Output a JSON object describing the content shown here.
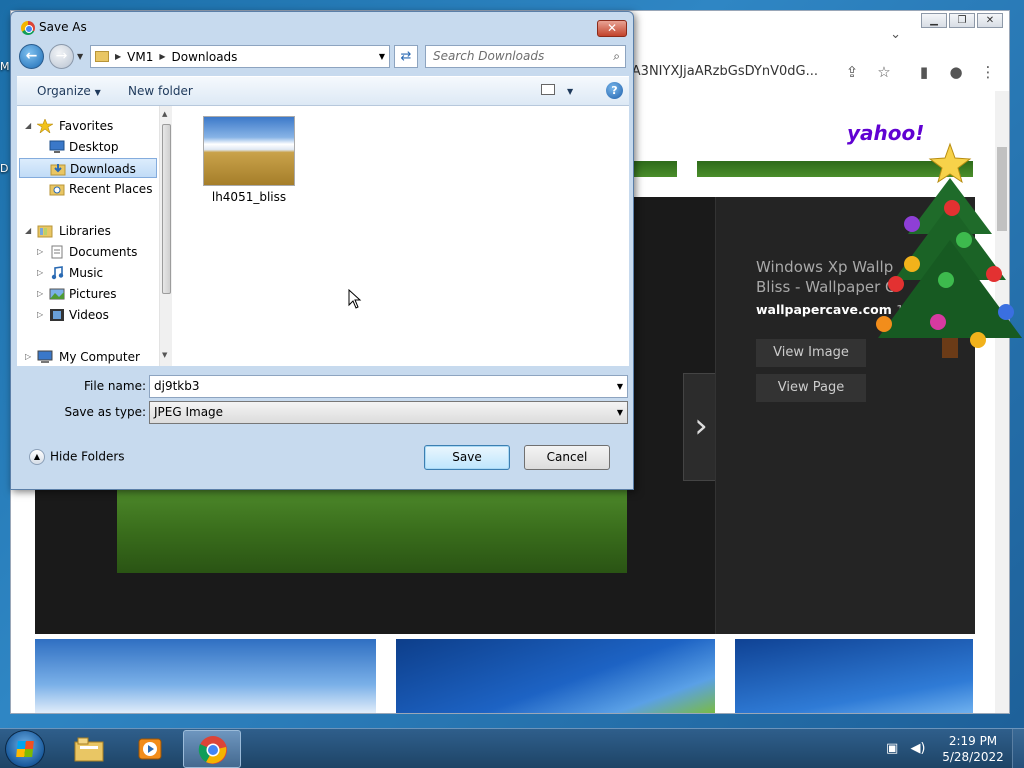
{
  "desktop": {
    "edge_labels": [
      "M",
      "D"
    ]
  },
  "browser": {
    "omnibox_text": "2VjA3NIYXJjaARzbGsDYnV0dG...",
    "window_controls": [
      "minimize",
      "restore",
      "close"
    ],
    "page": {
      "logo": "yahoo!",
      "viewer": {
        "title": "Windows Xp Wallpaper Bliss - Wallpaper Cave",
        "title_line1": "Windows Xp Wallp",
        "title_line2": "Bliss - Wallpaper C",
        "site": "wallpapercave.com",
        "site_suffix": "1",
        "view_image": "View Image",
        "view_page": "View Page",
        "next_arrow": "›"
      }
    }
  },
  "dialog": {
    "title": "Save As",
    "close_glyph": "✕",
    "breadcrumb": [
      "VM1",
      "Downloads"
    ],
    "search_placeholder": "Search Downloads",
    "commands": {
      "organize": "Organize",
      "new_folder": "New folder"
    },
    "nav_tree": [
      {
        "label": "Favorites",
        "icon": "star-icon",
        "level": 0,
        "expanded": true
      },
      {
        "label": "Desktop",
        "icon": "desktop-icon",
        "level": 1
      },
      {
        "label": "Downloads",
        "icon": "downloads-folder-icon",
        "level": 1,
        "selected": true
      },
      {
        "label": "Recent Places",
        "icon": "recent-places-icon",
        "level": 1
      },
      {
        "label": "Libraries",
        "icon": "libraries-icon",
        "level": 0,
        "expanded": true
      },
      {
        "label": "Documents",
        "icon": "documents-icon",
        "level": 1
      },
      {
        "label": "Music",
        "icon": "music-icon",
        "level": 1
      },
      {
        "label": "Pictures",
        "icon": "pictures-icon",
        "level": 1
      },
      {
        "label": "Videos",
        "icon": "videos-icon",
        "level": 1
      },
      {
        "label": "My Computer",
        "icon": "computer-icon",
        "level": 0
      }
    ],
    "files": [
      {
        "name": "lh4051_bliss",
        "type": "image"
      }
    ],
    "file_name_label": "File name:",
    "file_name_value": "dj9tkb3",
    "save_type_label": "Save as type:",
    "save_type_value": "JPEG Image",
    "hide_folders": "Hide Folders",
    "save_button": "Save",
    "cancel_button": "Cancel"
  },
  "taskbar": {
    "apps": [
      {
        "name": "file-explorer",
        "active": false
      },
      {
        "name": "media-player",
        "active": false
      },
      {
        "name": "chrome",
        "active": true
      }
    ],
    "time": "2:19 PM",
    "date": "5/28/2022"
  },
  "colors": {
    "dialog_frame": "#c7daee",
    "selection": "#c1dcf7",
    "yahoo_purple": "#6001d2",
    "taskbar": "#1e4466"
  }
}
